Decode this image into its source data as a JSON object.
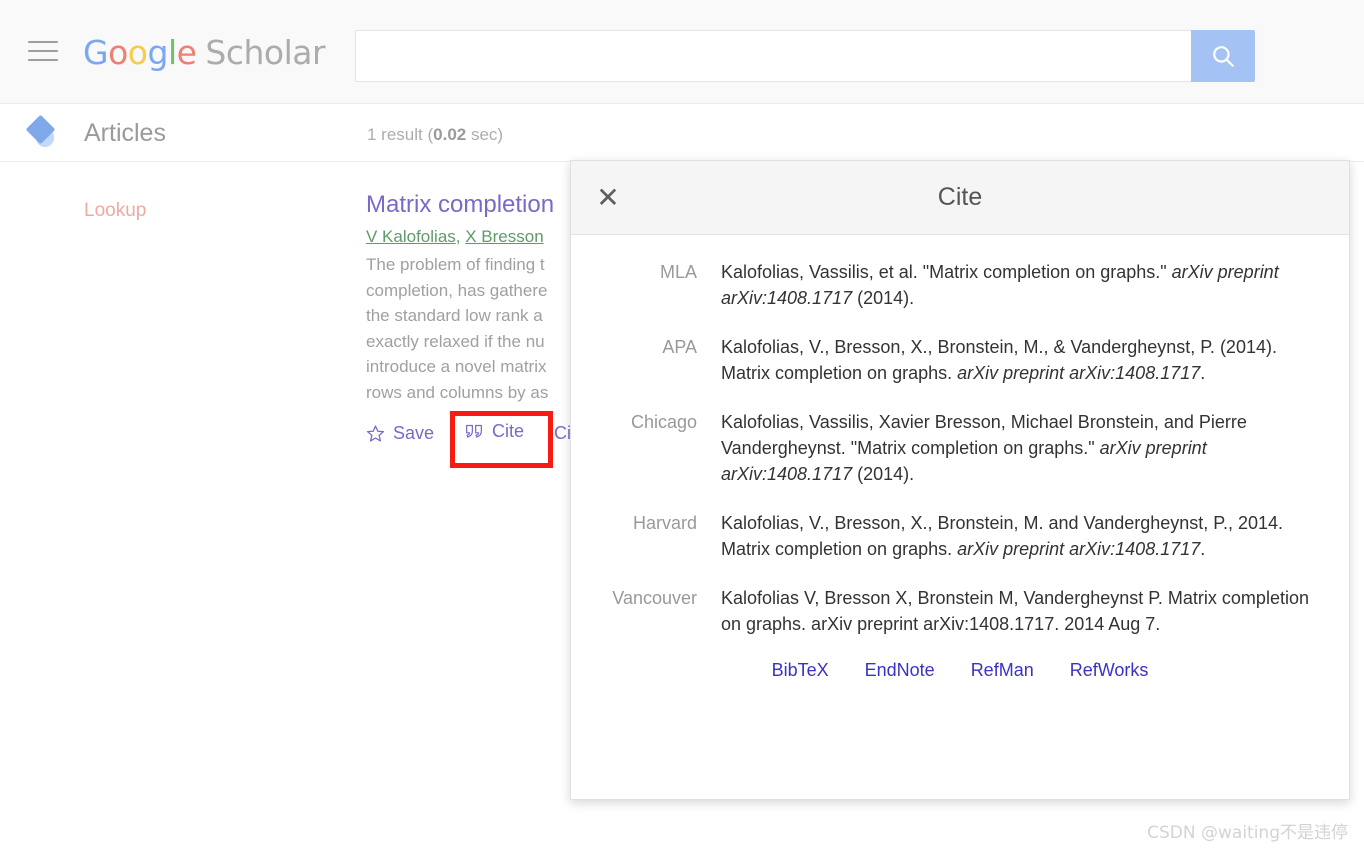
{
  "header": {
    "menu_icon": "hamburger-menu-icon",
    "logo": {
      "g1": "G",
      "o1": "o",
      "o2": "o",
      "g2": "g",
      "l1": "l",
      "e1": "e",
      "scholar": "Scholar",
      "colors": {
        "blue": "#7aa7f0",
        "red": "#ec8074",
        "yellow": "#f7ca51",
        "green": "#6cc06c",
        "gray": "#acacac"
      }
    },
    "search": {
      "value": "",
      "placeholder": "",
      "button_icon": "search-icon",
      "button_color": "#a4c2f4"
    }
  },
  "subheader": {
    "icon": "scholar-cap-icon",
    "articles_label": "Articles",
    "result_count_prefix": "1 result (",
    "result_count_time": "0.02",
    "result_count_suffix": " sec)"
  },
  "sidebar": {
    "items": [
      {
        "label": "Lookup",
        "color": "#eda9a2"
      }
    ]
  },
  "result": {
    "title": "Matrix completion",
    "authors": [
      {
        "name": "V Kalofolias"
      },
      {
        "name": "X Bresson"
      }
    ],
    "authors_separator": ", ",
    "snippet_lines": [
      "The problem of finding t",
      "completion, has gathere",
      "the standard low rank a",
      "exactly relaxed if the nu",
      "introduce a novel matrix",
      "rows and columns by as"
    ],
    "actions": [
      {
        "label": "Save",
        "icon": "star-icon"
      },
      {
        "label": "Cite",
        "icon": "quote-icon",
        "highlighted": true
      },
      {
        "label": "Ci",
        "icon": "none"
      }
    ],
    "highlight_color": "#f81b14"
  },
  "dialog": {
    "title": "Cite",
    "close_icon": "close-icon",
    "citations": [
      {
        "style": "MLA",
        "parts": [
          {
            "text": "Kalofolias, Vassilis, et al. \"Matrix completion on graphs.\" ",
            "italic": false
          },
          {
            "text": "arXiv preprint arXiv:1408.1717",
            "italic": true
          },
          {
            "text": " (2014).",
            "italic": false
          }
        ]
      },
      {
        "style": "APA",
        "parts": [
          {
            "text": "Kalofolias, V., Bresson, X., Bronstein, M., & Vandergheynst, P. (2014). Matrix completion on graphs. ",
            "italic": false
          },
          {
            "text": "arXiv preprint arXiv:1408.1717",
            "italic": true
          },
          {
            "text": ".",
            "italic": false
          }
        ]
      },
      {
        "style": "Chicago",
        "parts": [
          {
            "text": "Kalofolias, Vassilis, Xavier Bresson, Michael Bronstein, and Pierre Vandergheynst. \"Matrix completion on graphs.\" ",
            "italic": false
          },
          {
            "text": "arXiv preprint arXiv:1408.1717",
            "italic": true
          },
          {
            "text": " (2014).",
            "italic": false
          }
        ]
      },
      {
        "style": "Harvard",
        "parts": [
          {
            "text": "Kalofolias, V., Bresson, X., Bronstein, M. and Vandergheynst, P., 2014. Matrix completion on graphs. ",
            "italic": false
          },
          {
            "text": "arXiv preprint arXiv:1408.1717",
            "italic": true
          },
          {
            "text": ".",
            "italic": false
          }
        ]
      },
      {
        "style": "Vancouver",
        "parts": [
          {
            "text": "Kalofolias V, Bresson X, Bronstein M, Vandergheynst P. Matrix completion on graphs. arXiv preprint arXiv:1408.1717. 2014 Aug 7.",
            "italic": false
          }
        ]
      }
    ],
    "export_links": [
      {
        "label": "BibTeX"
      },
      {
        "label": "EndNote"
      },
      {
        "label": "RefMan"
      },
      {
        "label": "RefWorks"
      }
    ]
  },
  "watermark": "CSDN @waiting不是违停"
}
